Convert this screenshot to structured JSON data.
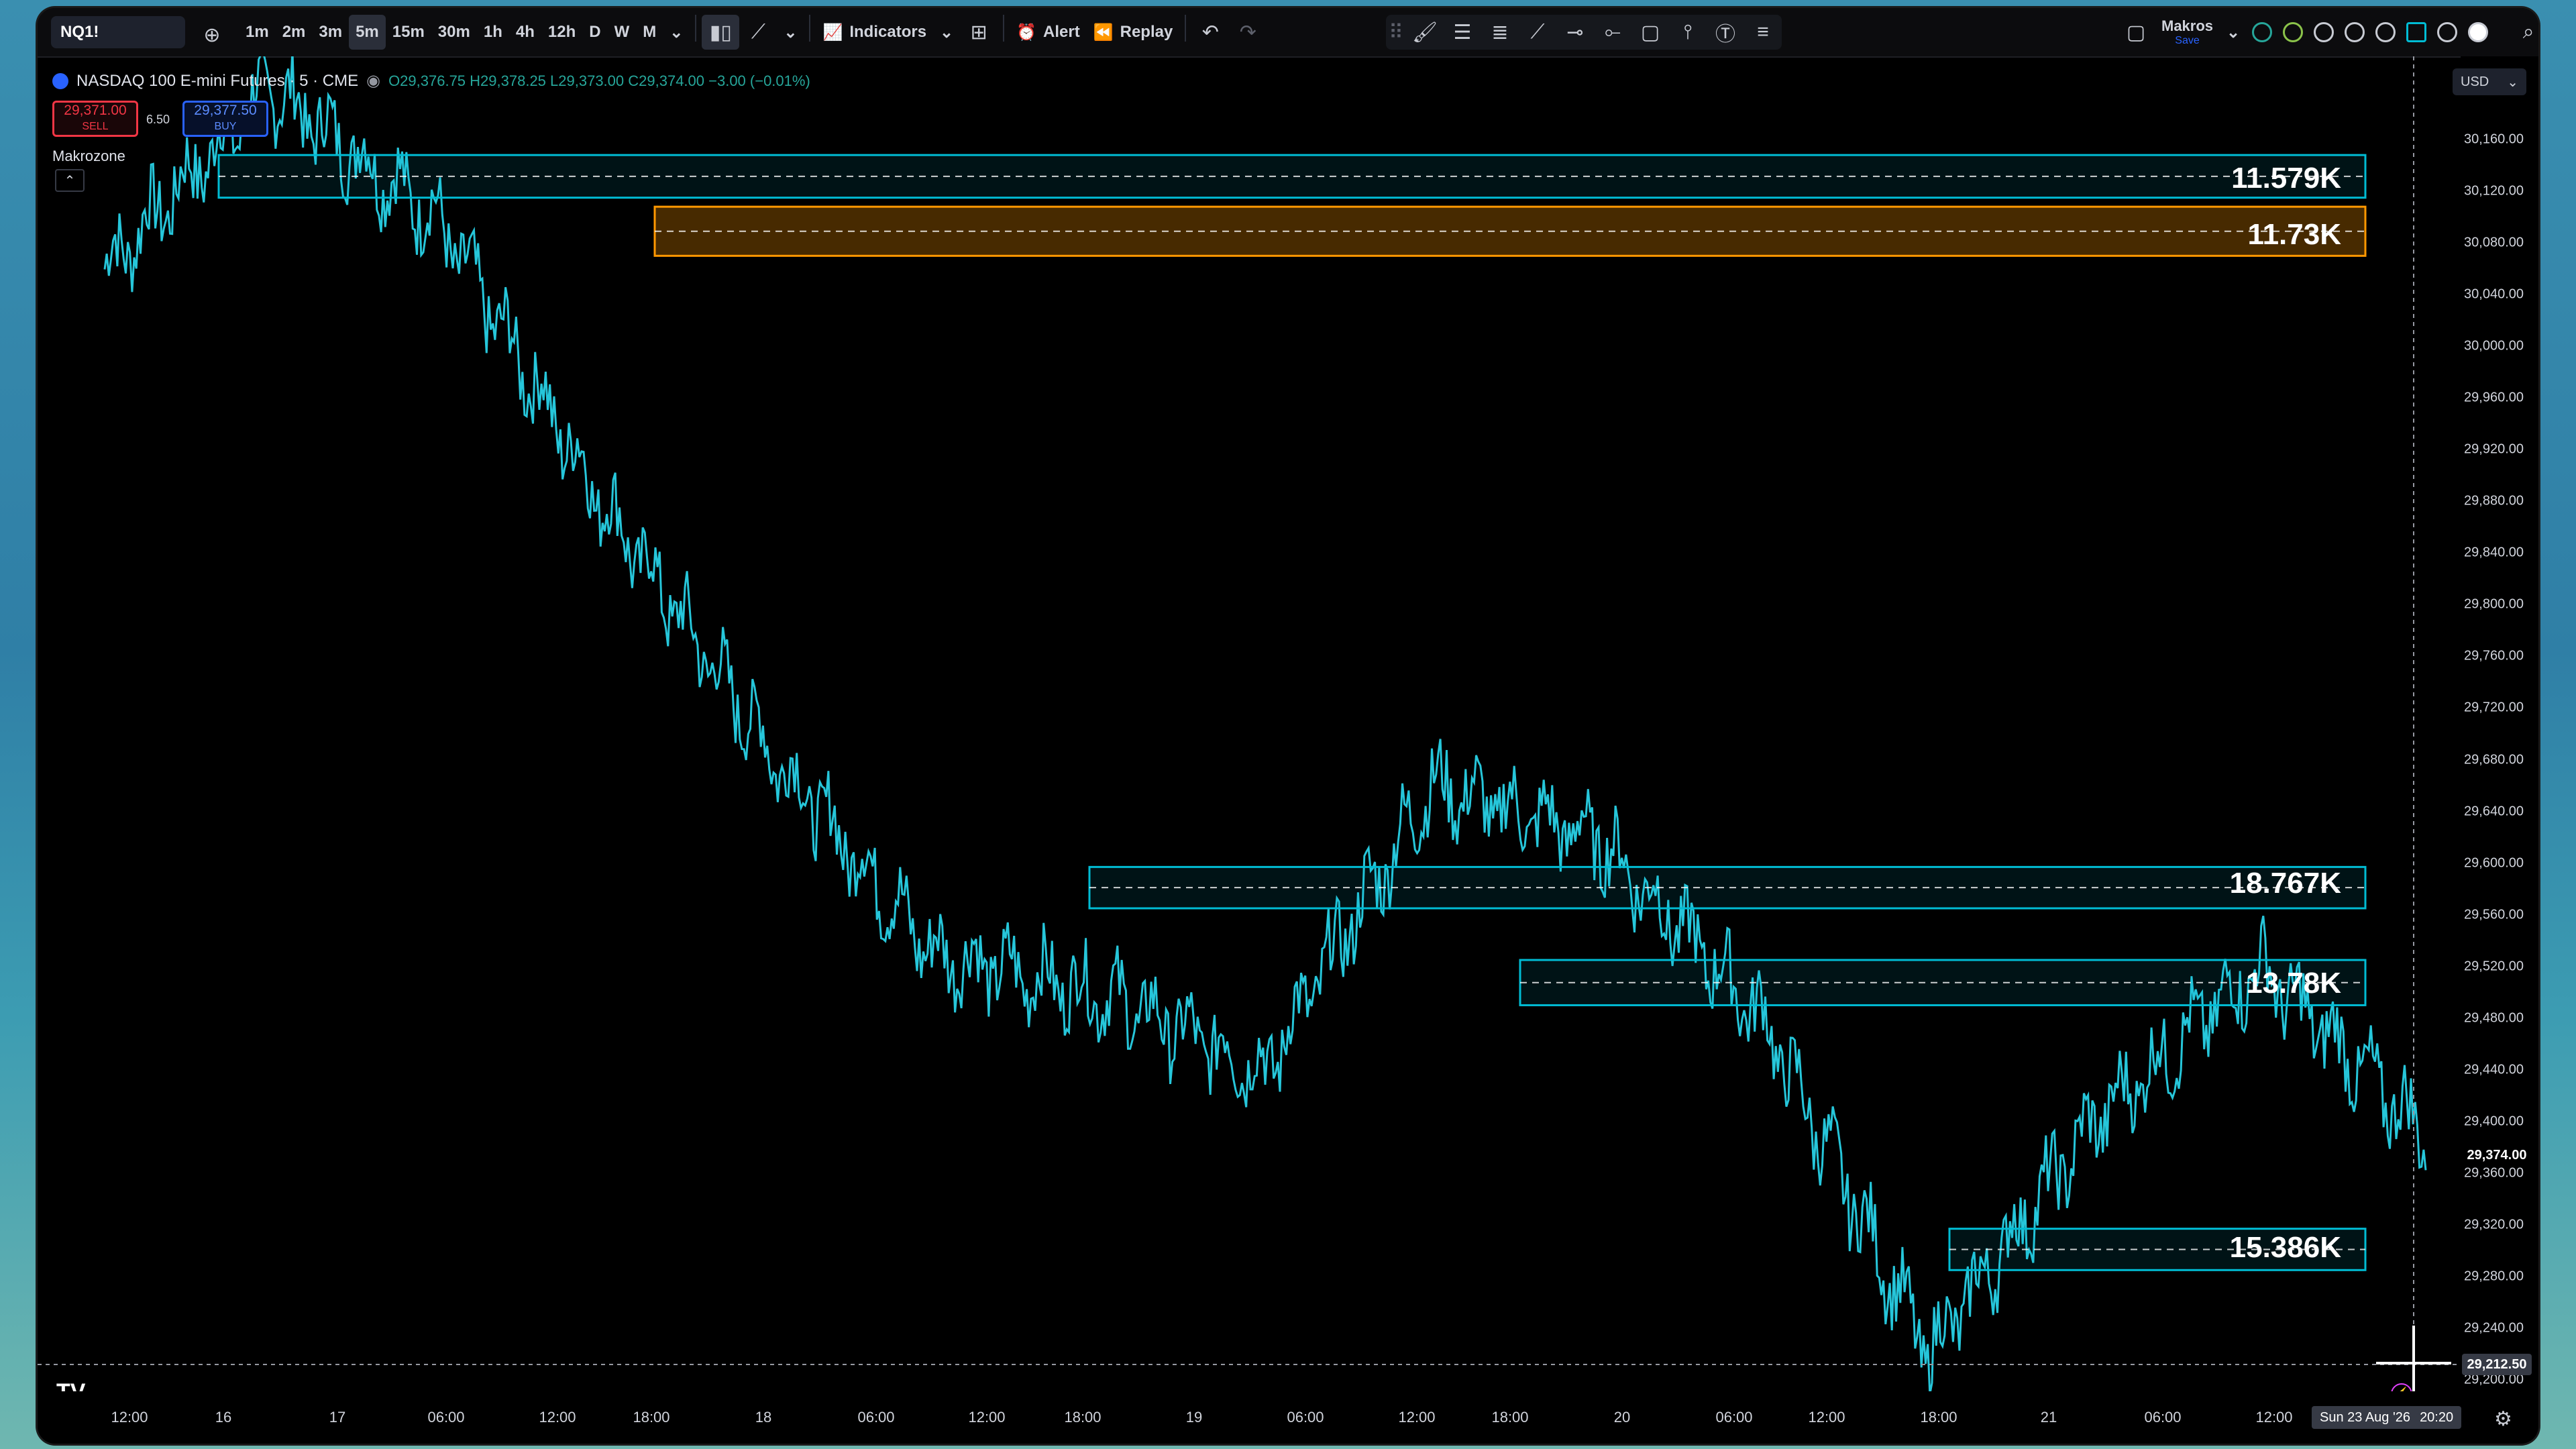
{
  "toolbar": {
    "symbol": "NQ1!",
    "timeframes": [
      "1m",
      "2m",
      "3m",
      "5m",
      "15m",
      "30m",
      "1h",
      "4h",
      "12h",
      "D",
      "W",
      "M"
    ],
    "active_timeframe": "5m",
    "indicators_label": "Indicators",
    "alert_label": "Alert",
    "replay_label": "Replay",
    "layout_name": "Makros",
    "layout_status": "Save"
  },
  "legend": {
    "title": "NASDAQ 100 E-mini Futures · 5 · CME",
    "ohlc": "O29,376.75 H29,378.25 L29,373.00 C29,374.00 −3.00 (−0.01%)",
    "sell_price": "29,371.00",
    "sell_label": "SELL",
    "spread": "6.50",
    "buy_price": "29,377.50",
    "buy_label": "BUY",
    "indicator_name": "Makrozone"
  },
  "currency": "USD",
  "price_axis": {
    "ticks": [
      "30,160.00",
      "30,120.00",
      "30,080.00",
      "30,040.00",
      "30,000.00",
      "29,960.00",
      "29,920.00",
      "29,880.00",
      "29,840.00",
      "29,800.00",
      "29,760.00",
      "29,720.00",
      "29,680.00",
      "29,640.00",
      "29,600.00",
      "29,560.00",
      "29,520.00",
      "29,480.00",
      "29,440.00",
      "29,400.00",
      "29,360.00",
      "29,320.00",
      "29,280.00",
      "29,240.00",
      "29,200.00"
    ],
    "current_price": "29,374.00",
    "crosshair_price": "29,212.50"
  },
  "time_axis": {
    "ticks": [
      "12:00",
      "16",
      "17",
      "06:00",
      "12:00",
      "18:00",
      "18",
      "06:00",
      "12:00",
      "18:00",
      "19",
      "06:00",
      "12:00",
      "18:00",
      "20",
      "06:00",
      "12:00",
      "18:00",
      "21",
      "06:00",
      "12:00"
    ],
    "cursor_label": "Sun 23 Aug '26",
    "cursor_time": "20:20"
  },
  "zones": [
    {
      "label": "11.579K",
      "color": "#00bcd4"
    },
    {
      "label": "11.73K",
      "color": "#ff9800"
    },
    {
      "label": "18.767K",
      "color": "#00bcd4"
    },
    {
      "label": "13.78K",
      "color": "#00bcd4"
    },
    {
      "label": "15.386K",
      "color": "#00bcd4"
    }
  ],
  "chart_data": {
    "type": "line",
    "ylim": [
      29190,
      30180
    ],
    "x": [
      "16 12:00",
      "17 06:00",
      "17 12:00",
      "17 18:00",
      "18 06:00",
      "18 12:00",
      "18 18:00",
      "19 06:00",
      "19 12:00",
      "19 18:00",
      "20 06:00",
      "20 12:00",
      "20 18:00",
      "21 06:00",
      "21 12:00"
    ],
    "series": [
      {
        "values": [
          30060,
          30200,
          30100,
          29880,
          29690,
          29530,
          29500,
          29440,
          29660,
          29620,
          29480,
          29220,
          29400,
          29520,
          29390
        ]
      }
    ],
    "zones": [
      {
        "y_low": 30115,
        "y_high": 30148,
        "value": "11.579K"
      },
      {
        "y_low": 30070,
        "y_high": 30108,
        "value": "11.73K"
      },
      {
        "y_low": 29565,
        "y_high": 29597,
        "value": "18.767K"
      },
      {
        "y_low": 29490,
        "y_high": 29525,
        "value": "13.78K"
      },
      {
        "y_low": 29285,
        "y_high": 29317,
        "value": "15.386K"
      }
    ]
  }
}
